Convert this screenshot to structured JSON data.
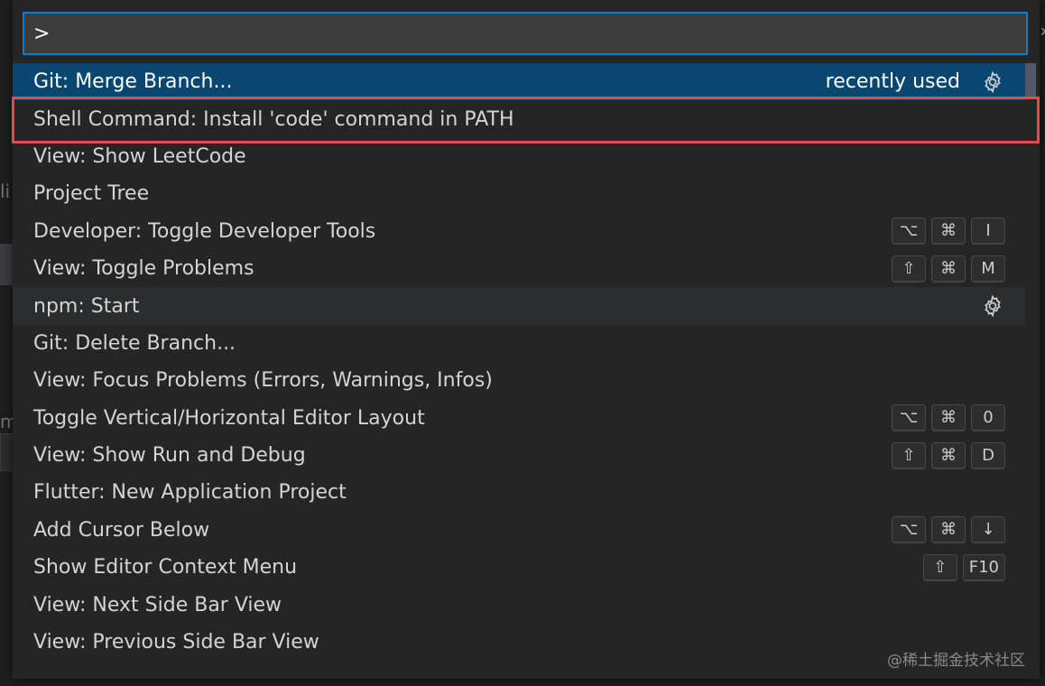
{
  "command_palette": {
    "input_value": ">",
    "items": [
      {
        "label": "Git: Merge Branch...",
        "tag": "recently used",
        "gear": true,
        "keys": []
      },
      {
        "label": "Shell Command: Install 'code' command in PATH",
        "tag": "",
        "gear": false,
        "keys": []
      },
      {
        "label": "View: Show LeetCode",
        "tag": "",
        "gear": false,
        "keys": []
      },
      {
        "label": "Project Tree",
        "tag": "",
        "gear": false,
        "keys": []
      },
      {
        "label": "Developer: Toggle Developer Tools",
        "tag": "",
        "gear": false,
        "keys": [
          "⌥",
          "⌘",
          "I"
        ]
      },
      {
        "label": "View: Toggle Problems",
        "tag": "",
        "gear": false,
        "keys": [
          "⇧",
          "⌘",
          "M"
        ]
      },
      {
        "label": "npm: Start",
        "tag": "",
        "gear": true,
        "keys": []
      },
      {
        "label": "Git: Delete Branch...",
        "tag": "",
        "gear": false,
        "keys": []
      },
      {
        "label": "View: Focus Problems (Errors, Warnings, Infos)",
        "tag": "",
        "gear": false,
        "keys": []
      },
      {
        "label": "Toggle Vertical/Horizontal Editor Layout",
        "tag": "",
        "gear": false,
        "keys": [
          "⌥",
          "⌘",
          "0"
        ]
      },
      {
        "label": "View: Show Run and Debug",
        "tag": "",
        "gear": false,
        "keys": [
          "⇧",
          "⌘",
          "D"
        ]
      },
      {
        "label": "Flutter: New Application Project",
        "tag": "",
        "gear": false,
        "keys": []
      },
      {
        "label": "Add Cursor Below",
        "tag": "",
        "gear": false,
        "keys": [
          "⌥",
          "⌘",
          "↓"
        ]
      },
      {
        "label": "Show Editor Context Menu",
        "tag": "",
        "gear": false,
        "keys": [
          "⇧",
          "F10"
        ]
      },
      {
        "label": "View: Next Side Bar View",
        "tag": "",
        "gear": false,
        "keys": []
      },
      {
        "label": "View: Previous Side Bar View",
        "tag": "",
        "gear": false,
        "keys": []
      }
    ]
  },
  "background": {
    "letter_1": "li",
    "letter_2": "m"
  },
  "watermark": "@稀土掘金技术社区",
  "colors": {
    "selected_bg": "#094771",
    "focus_border": "#007fd4",
    "highlight_box": "#e5484d"
  }
}
